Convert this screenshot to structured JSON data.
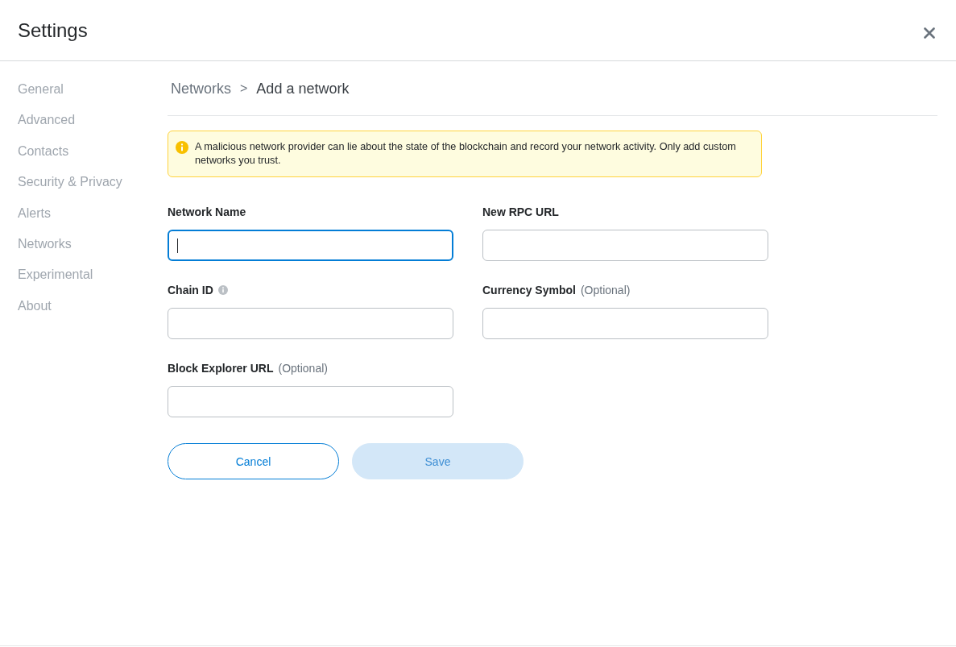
{
  "window": {
    "title": "Settings"
  },
  "sidebar": {
    "items": [
      {
        "label": "General"
      },
      {
        "label": "Advanced"
      },
      {
        "label": "Contacts"
      },
      {
        "label": "Security & Privacy"
      },
      {
        "label": "Alerts"
      },
      {
        "label": "Networks"
      },
      {
        "label": "Experimental"
      },
      {
        "label": "About"
      }
    ]
  },
  "breadcrumb": {
    "parent": "Networks",
    "separator": ">",
    "current": "Add a network"
  },
  "warning": {
    "text": "A malicious network provider can lie about the state of the blockchain and record your network activity. Only add custom networks you trust."
  },
  "form": {
    "fields": [
      {
        "label": "Network Name",
        "info": false,
        "focused": true
      },
      {
        "label": "New RPC URL",
        "info": false,
        "focused": false
      },
      {
        "label": "Chain ID",
        "info": true,
        "focused": false
      },
      {
        "label": "Currency Symbol",
        "hint": "(Optional)",
        "info": false,
        "focused": false
      },
      {
        "label": "Block Explorer URL",
        "hint": "(Optional)",
        "info": false,
        "focused": false
      }
    ]
  },
  "buttons": [
    {
      "label": "Cancel",
      "kind": "secondary",
      "disabled": false
    },
    {
      "label": "Save",
      "kind": "primary",
      "disabled": true
    }
  ]
}
